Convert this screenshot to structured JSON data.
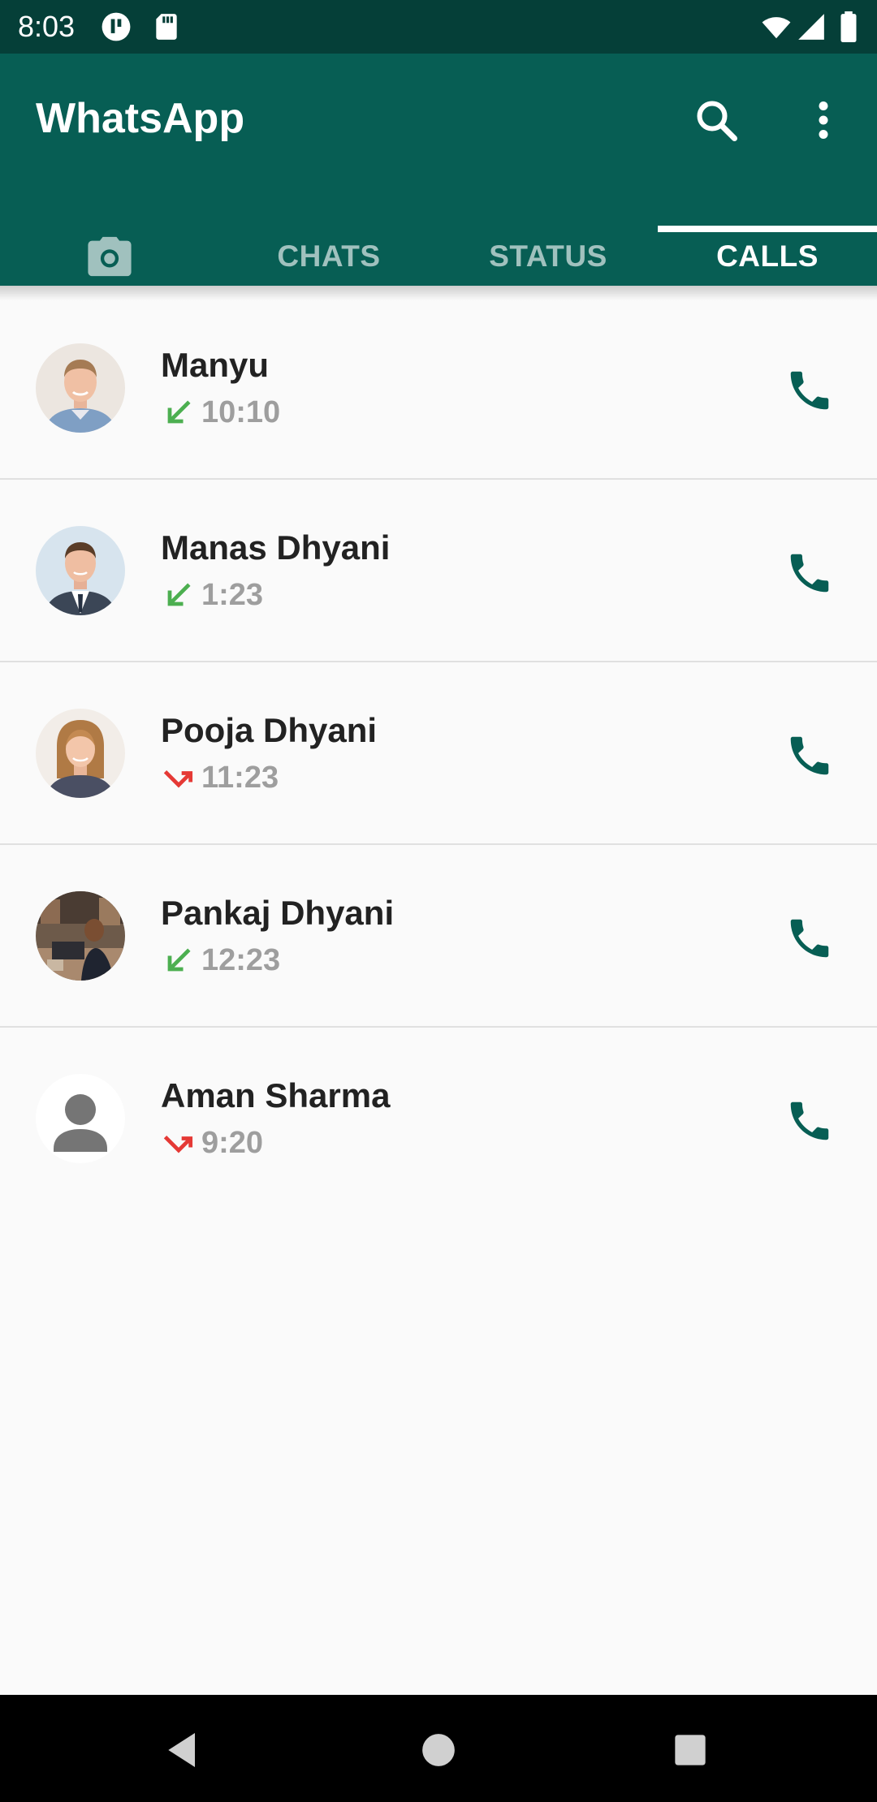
{
  "status_bar": {
    "time": "8:03",
    "left_icons": [
      "notification-icon",
      "sd-card-icon"
    ],
    "right_icons": [
      "wifi-icon",
      "signal-icon",
      "battery-icon"
    ]
  },
  "app_bar": {
    "title": "WhatsApp",
    "actions": [
      "search-icon",
      "more-vert-icon"
    ]
  },
  "tabs": [
    {
      "icon": "camera-icon",
      "label": ""
    },
    {
      "label": "CHATS"
    },
    {
      "label": "STATUS"
    },
    {
      "label": "CALLS",
      "active": true
    }
  ],
  "calls": [
    {
      "name": "Manyu",
      "time": "10:10",
      "direction": "incoming",
      "avatar": "photo"
    },
    {
      "name": "Manas Dhyani",
      "time": "1:23",
      "direction": "incoming",
      "avatar": "photo"
    },
    {
      "name": "Pooja Dhyani",
      "time": "11:23",
      "direction": "missed",
      "avatar": "photo"
    },
    {
      "name": "Pankaj Dhyani",
      "time": "12:23",
      "direction": "incoming",
      "avatar": "photo"
    },
    {
      "name": "Aman Sharma",
      "time": "9:20",
      "direction": "missed",
      "avatar": "default-avatar-icon"
    }
  ],
  "colors": {
    "primary": "#075e54",
    "primary_dark": "#053f38",
    "incoming_arrow": "#4caf50",
    "missed_arrow": "#e53935",
    "call_icon": "#075e54",
    "secondary_text": "#9e9e9e"
  },
  "nav_bar": [
    "back-icon",
    "home-icon",
    "recents-icon"
  ]
}
